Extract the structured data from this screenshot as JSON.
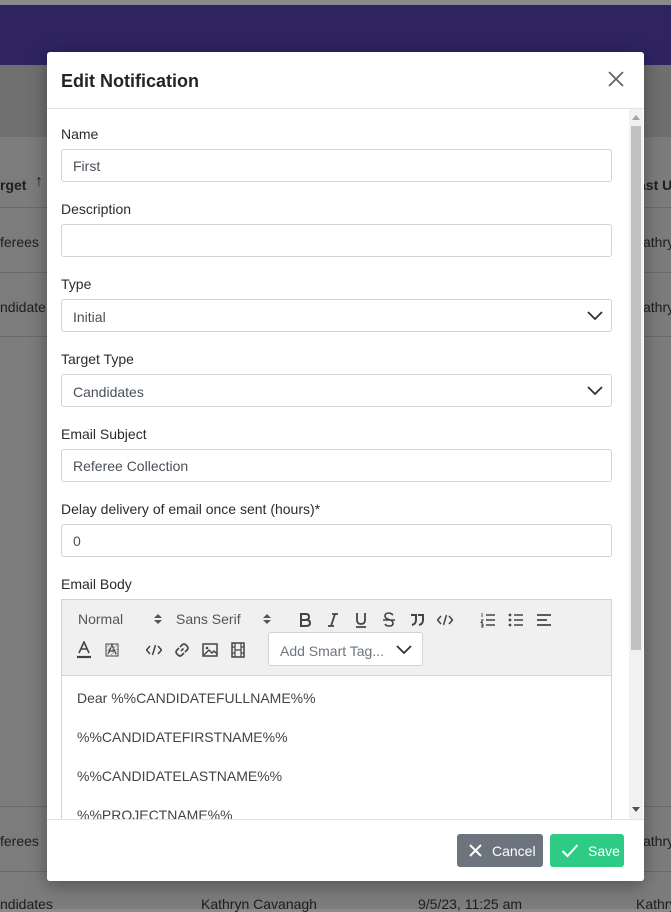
{
  "background": {
    "columns": {
      "target": "rget",
      "last_updated": "ast U"
    },
    "rows": [
      {
        "target": "ferees",
        "user": "",
        "date": "",
        "last": "athry"
      },
      {
        "target": "ndidate",
        "user": "",
        "date": "",
        "last": "athry"
      },
      {
        "target": "ferees",
        "user": "",
        "date": "",
        "last": "athry"
      },
      {
        "target": "ndidates",
        "user": "Kathryn Cavanagh",
        "date": "9/5/23, 11:25 am",
        "last": "Kathry"
      }
    ]
  },
  "modal": {
    "title": "Edit Notification",
    "fields": {
      "name": {
        "label": "Name",
        "value": "First"
      },
      "description": {
        "label": "Description",
        "value": ""
      },
      "type": {
        "label": "Type",
        "value": "Initial"
      },
      "target_type": {
        "label": "Target Type",
        "value": "Candidates"
      },
      "email_subject": {
        "label": "Email Subject",
        "value": "Referee Collection"
      },
      "delay": {
        "label": "Delay delivery of email once sent (hours)*",
        "value": "0"
      },
      "email_body": {
        "label": "Email Body"
      }
    },
    "editor": {
      "format_select": "Normal",
      "font_select": "Sans Serif",
      "smart_tag_placeholder": "Add Smart Tag...",
      "lines": [
        "Dear %%CANDIDATEFULLNAME%%",
        "%%CANDIDATEFIRSTNAME%%",
        "%%CANDIDATELASTNAME%%",
        "%%PROJECTNAME%%"
      ]
    },
    "buttons": {
      "cancel": "Cancel",
      "save": "Save"
    }
  },
  "colors": {
    "topbar": "#2f2460",
    "cancel": "#6c757d",
    "save": "#2dcb84"
  }
}
